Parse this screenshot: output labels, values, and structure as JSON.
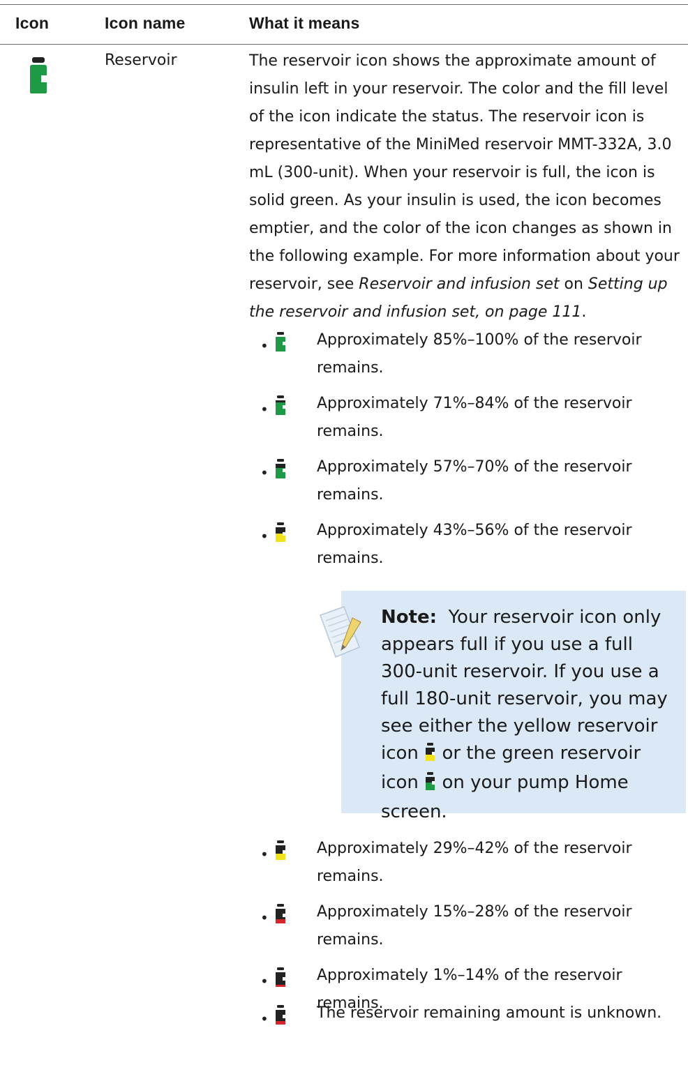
{
  "table": {
    "headers": {
      "icon": "Icon",
      "name": "Icon name",
      "meaning": "What it means"
    }
  },
  "row": {
    "icon": "reservoir-icon",
    "name": "Reservoir",
    "description_parts": [
      "The reservoir icon shows the approximate amount of insulin left in your reservoir. The color and the fill level of the icon indicate the status. The reservoir icon is representative of the MiniMed reservoir MMT-332A, 3.0 mL (300-unit). When your reservoir is full, the icon is solid green. As your insulin is used, the icon becomes emptier, and the color of the icon changes as shown in the following example. For more information about your reservoir, see ",
      "Reservoir and infusion set",
      " on ",
      "Setting up the reservoir and infusion set, on page 111",
      "."
    ]
  },
  "levels": [
    {
      "text": "Approximately 85%–100% of the reservoir remains.",
      "icon": "reservoir-green-full-icon",
      "color": "#1e9a46",
      "fill": 1.0
    },
    {
      "text": "Approximately 71%–84% of the reservoir remains.",
      "icon": "reservoir-green-icon",
      "color": "#1e9a46",
      "fill": 0.84
    },
    {
      "text": "Approximately 57%–70% of the reservoir remains.",
      "icon": "reservoir-green-icon",
      "color": "#1e9a46",
      "fill": 0.7
    },
    {
      "text": "Approximately 43%–56% of the reservoir remains.",
      "icon": "reservoir-yellow-icon",
      "color": "#f2e21b",
      "fill": 0.56
    },
    {
      "text": "Approximately 29%–42% of the reservoir remains.",
      "icon": "reservoir-yellow-icon",
      "color": "#f2e21b",
      "fill": 0.42
    },
    {
      "text": "Approximately 15%–28% of the reservoir remains.",
      "icon": "reservoir-red-icon",
      "color": "#d7262b",
      "fill": 0.28
    },
    {
      "text": "Approximately 1%–14% of the reservoir remains.",
      "icon": "reservoir-red-icon",
      "color": "#d7262b",
      "fill": 0.14
    },
    {
      "text": "The reservoir remaining amount is unknown.",
      "icon": "reservoir-unknown-icon",
      "color": "#d7262b",
      "fill": 0.0
    }
  ],
  "note": {
    "label": "Note:",
    "text_1": "Your reservoir icon only appears full if you use a full 300-unit reservoir. If you use a full 180-unit reservoir, you may see either the yellow reservoir icon",
    "text_2": "or the green reservoir icon",
    "text_3": "on your pump Home screen."
  },
  "colors": {
    "green": "#1e9a46",
    "yellow": "#f2e21b",
    "red": "#d7262b",
    "cap": "#222222",
    "note_bg": "#dbe9f6"
  }
}
